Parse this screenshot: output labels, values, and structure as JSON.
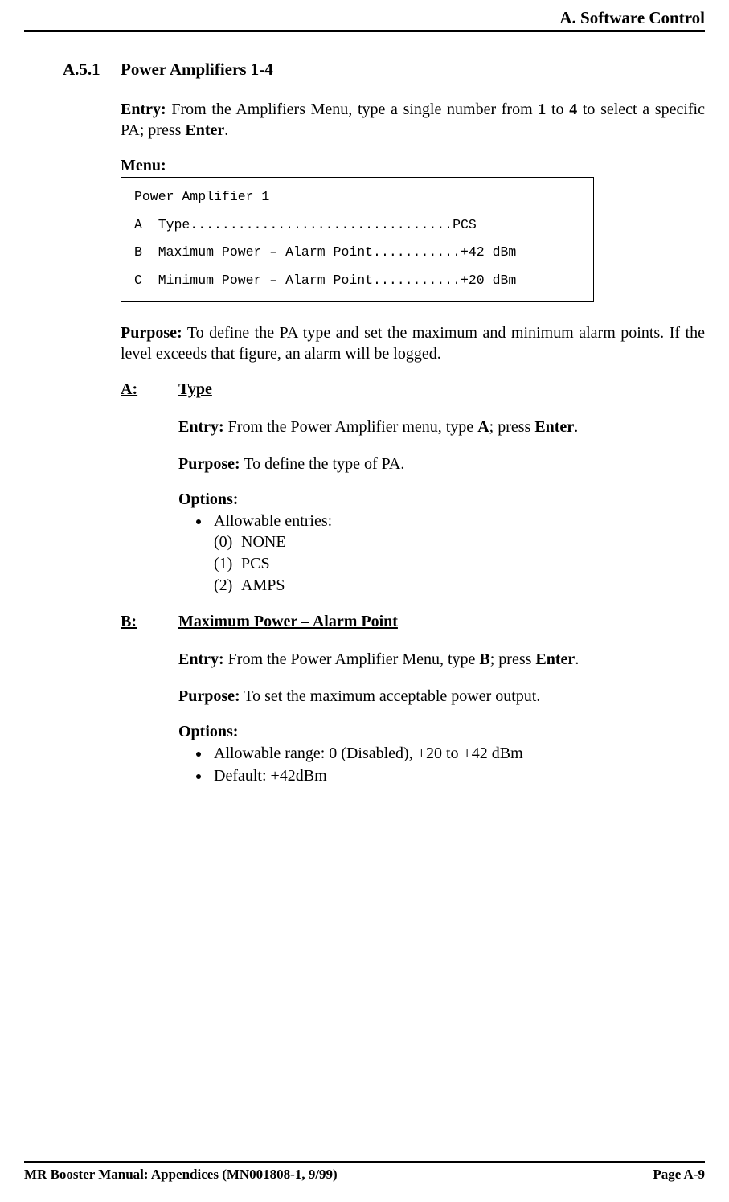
{
  "header": {
    "title": "A. Software Control"
  },
  "section": {
    "number": "A.5.1",
    "title": "Power Amplifiers 1-4"
  },
  "entry": {
    "label": "Entry:",
    "pre": " From the Amplifiers Menu, type a single number from ",
    "n1": "1",
    "mid": " to ",
    "n2": "4",
    "post": " to select a specific PA; press ",
    "enter": "Enter",
    "end": "."
  },
  "menu": {
    "label": "Menu:",
    "lines": {
      "l0": "Power Amplifier 1",
      "l1": "A  Type.................................PCS",
      "l2": "B  Maximum Power – Alarm Point...........+42 dBm",
      "l3": "C  Minimum Power – Alarm Point...........+20 dBm"
    }
  },
  "purpose": {
    "label": "Purpose:",
    "text": " To define the PA type and set the maximum and minimum alarm points. If the level exceeds that figure, an alarm will be logged."
  },
  "subA": {
    "key": "A:",
    "title": "Type",
    "entry": {
      "label": "Entry:",
      "pre": " From the Power Amplifier menu, type ",
      "k": "A",
      "post": "; press ",
      "enter": "Enter",
      "end": "."
    },
    "purpose": {
      "label": "Purpose:",
      "text": " To define the type of PA."
    },
    "options_label": "Options:",
    "bullet": "Allowable entries:",
    "opts": {
      "o0n": "(0)",
      "o0t": "NONE",
      "o1n": "(1)",
      "o1t": "PCS",
      "o2n": "(2)",
      "o2t": "AMPS"
    }
  },
  "subB": {
    "key": "B:",
    "title": "Maximum Power – Alarm Point",
    "entry": {
      "label": "Entry:",
      "pre": " From the Power Amplifier Menu, type ",
      "k": "B",
      "post": "; press ",
      "enter": "Enter",
      "end": "."
    },
    "purpose": {
      "label": "Purpose:",
      "text": " To set the maximum acceptable power output."
    },
    "options_label": "Options:",
    "b1": "Allowable range: 0 (Disabled), +20 to +42 dBm",
    "b2": "Default: +42dBm"
  },
  "footer": {
    "left": "MR Booster Manual: Appendices (MN001808-1, 9/99)",
    "right": "Page A-9"
  }
}
